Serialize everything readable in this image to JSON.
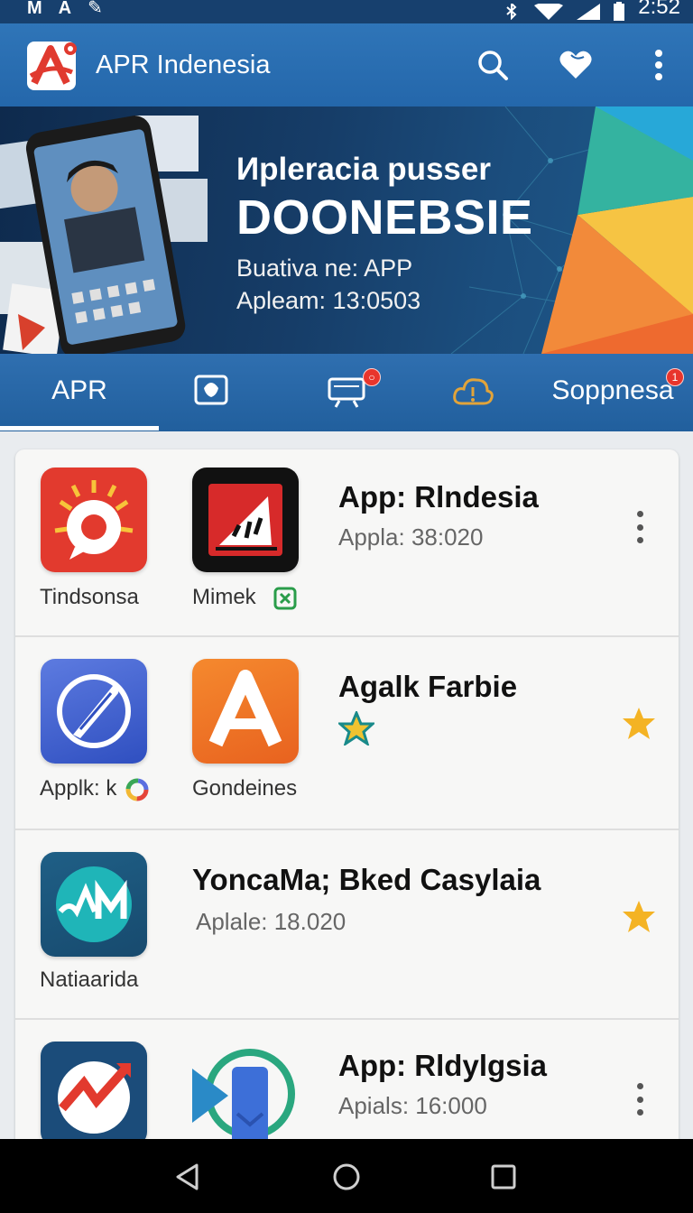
{
  "status_bar": {
    "left_glyphs": [
      "M",
      "A",
      "✎"
    ],
    "time": "2:52",
    "icons": [
      "bluetooth-icon",
      "wifi-icon",
      "signal-icon",
      "battery-icon"
    ]
  },
  "app_bar": {
    "title": "APR Indenesia",
    "actions": [
      "search-icon",
      "favorite-icon",
      "more-vert-icon"
    ]
  },
  "banner": {
    "line1": "Иpleracia pusser",
    "line2": "DOONEBSIE",
    "line3": "Buativa ne: APP",
    "line4": "Apleam:  13:0503"
  },
  "tabs": {
    "items": [
      {
        "label": "APR",
        "icon": null,
        "badge": null,
        "active": true
      },
      {
        "label": "",
        "icon": "chat-bubble-icon",
        "badge": null,
        "active": false
      },
      {
        "label": "",
        "icon": "display-icon",
        "badge": "○",
        "active": false
      },
      {
        "label": "",
        "icon": "cloud-alert-icon",
        "badge": null,
        "active": false
      },
      {
        "label": "Soppnesa",
        "icon": null,
        "badge": "1",
        "active": false
      }
    ]
  },
  "list": {
    "rows": [
      {
        "icons": [
          {
            "label": "Tindsonsa",
            "name": "sun-chat-icon"
          },
          {
            "label": "Mimek",
            "name": "warning-app-icon",
            "label_badge": "close-box-icon"
          }
        ],
        "title": "App: Rlndesia",
        "subtitle": "Appla: 38:020",
        "action": "more-vert-icon"
      },
      {
        "icons": [
          {
            "label": "Applk: k",
            "name": "compass-pen-icon",
            "label_badge": "color-ring-icon"
          },
          {
            "label": "Gondeines",
            "name": "letter-a-icon"
          }
        ],
        "title": "Agalk Farbie",
        "subtitle": "",
        "subtitle_icon": "teal-star-icon",
        "action": "star-icon"
      },
      {
        "icons": [
          {
            "label": "Natiaarida",
            "name": "wave-am-icon"
          }
        ],
        "title": "YoncaMa; Bked Casylaia",
        "subtitle": "Aplale: 18.020",
        "action": "star-icon"
      },
      {
        "icons": [
          {
            "label": "",
            "name": "trend-circle-icon"
          },
          {
            "label": "",
            "name": "bookmark-play-icon"
          }
        ],
        "title": "App: Rldylgsia",
        "subtitle": "Apials: 16:000",
        "action": "more-vert-icon"
      }
    ]
  },
  "nav_bar": {
    "buttons": [
      "back-icon",
      "home-icon",
      "recents-icon"
    ]
  },
  "colors": {
    "primary": "#2a6db0",
    "status_bar": "#17406e",
    "star": "#f4b324",
    "badge": "#e8352c"
  }
}
